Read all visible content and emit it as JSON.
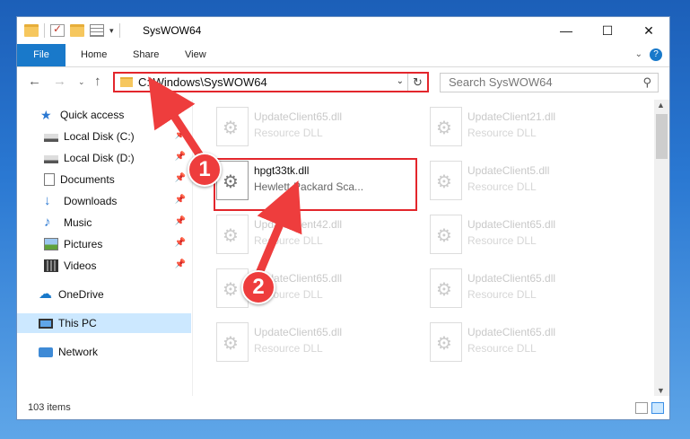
{
  "window": {
    "title": "SysWOW64",
    "controls": {
      "minimize": "—",
      "maximize": "☐",
      "close": "✕"
    }
  },
  "ribbon": {
    "tabs": [
      "File",
      "Home",
      "Share",
      "View"
    ],
    "expand": "⌄",
    "help": "?"
  },
  "address": {
    "path": "C:\\Windows\\SysWOW64",
    "dropdown": "⌄",
    "refresh": "↻"
  },
  "search": {
    "placeholder": "Search SysWOW64",
    "icon": "search-icon"
  },
  "nav_buttons": {
    "back": "←",
    "forward": "→",
    "recent": "⌄",
    "up": "↑"
  },
  "sidebar": {
    "items": [
      {
        "label": "Quick access",
        "icon": "star-icon",
        "pinned": false
      },
      {
        "label": "Local Disk (C:)",
        "icon": "drive-icon",
        "pinned": true
      },
      {
        "label": "Local Disk (D:)",
        "icon": "drive-icon",
        "pinned": true
      },
      {
        "label": "Documents",
        "icon": "documents-icon",
        "pinned": true
      },
      {
        "label": "Downloads",
        "icon": "downloads-icon",
        "pinned": true
      },
      {
        "label": "Music",
        "icon": "music-icon",
        "pinned": true
      },
      {
        "label": "Pictures",
        "icon": "pictures-icon",
        "pinned": true
      },
      {
        "label": "Videos",
        "icon": "videos-icon",
        "pinned": true
      },
      {
        "label": "OneDrive",
        "icon": "onedrive-icon",
        "pinned": false
      },
      {
        "label": "This PC",
        "icon": "this-pc-icon",
        "pinned": false,
        "selected": true
      },
      {
        "label": "Network",
        "icon": "network-icon",
        "pinned": false
      }
    ]
  },
  "files": [
    {
      "name": "UpdateClient65.dll",
      "type": "Resource DLL"
    },
    {
      "name": "UpdateClient21.dll",
      "type": "Resource DLL"
    },
    {
      "name": "hpgt33tk.dll",
      "type": "Hewlett-Packard Sca...",
      "highlighted": true
    },
    {
      "name": "UpdateClient5.dll",
      "type": "Resource DLL"
    },
    {
      "name": "UpdateClient42.dll",
      "type": "Resource DLL"
    },
    {
      "name": "UpdateClient65.dll",
      "type": "Resource DLL"
    },
    {
      "name": "UpdateClient65.dll",
      "type": "Resource DLL"
    },
    {
      "name": "UpdateClient65.dll",
      "type": "Resource DLL"
    },
    {
      "name": "UpdateClient65.dll",
      "type": "Resource DLL"
    },
    {
      "name": "UpdateClient65.dll",
      "type": "Resource DLL"
    }
  ],
  "status": {
    "item_count": "103 items"
  },
  "annotations": {
    "step1": "1",
    "step2": "2",
    "color": "#e3262c"
  }
}
